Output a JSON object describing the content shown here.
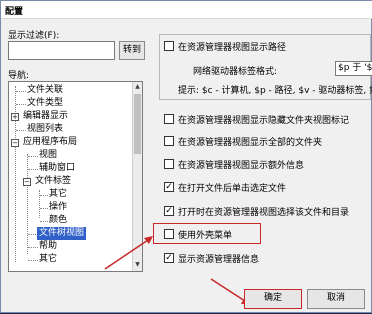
{
  "window": {
    "title": "配置"
  },
  "filter": {
    "label": "显示过滤(F):",
    "value": "",
    "button_label": "转到"
  },
  "nav": {
    "label": "导航:"
  },
  "tree": {
    "items": [
      {
        "label": "文件关联"
      },
      {
        "label": "文件类型"
      },
      {
        "label": "编辑器显示"
      },
      {
        "label": "视图列表"
      },
      {
        "label": "应用程序布局"
      },
      {
        "label": "视图"
      },
      {
        "label": "辅助窗口"
      },
      {
        "label": "文件标签"
      },
      {
        "label": "其它"
      },
      {
        "label": "操作"
      },
      {
        "label": "颜色"
      },
      {
        "label": "文件树视图"
      },
      {
        "label": "帮助"
      },
      {
        "label": "其它"
      }
    ],
    "selected_index": 11
  },
  "options": {
    "show_path_in_title": {
      "label": "在资源管理器视图显示路径",
      "checked": false
    },
    "path_format_label": "网络驱动器标签格式:",
    "path_format_value": "$p 于 '$c",
    "path_format_hint": "提示: $c - 计算机, $p - 路径, $v - 驱动器标签, 剩余 [x]",
    "show_hidden_files": {
      "label": "在资源管理器视图显示隐藏文件夹视图标记",
      "checked": false
    },
    "show_all_files": {
      "label": "在资源管理器视图显示全部的文件夹",
      "checked": false
    },
    "show_extra_info": {
      "label": "在资源管理器视图显示额外信息",
      "checked": false
    },
    "open_file_on_click": {
      "label": "在打开文件后单击选定文件",
      "checked": true
    },
    "open_in_explorer": {
      "label": "打开时在资源管理器视图选择该文件和目录",
      "checked": true
    },
    "use_shell_menu": {
      "label": "使用外壳菜单",
      "checked": false
    },
    "show_file_icons": {
      "label": "显示资源管理器信息",
      "checked": true
    }
  },
  "buttons": {
    "ok": "确定",
    "cancel": "取消"
  }
}
